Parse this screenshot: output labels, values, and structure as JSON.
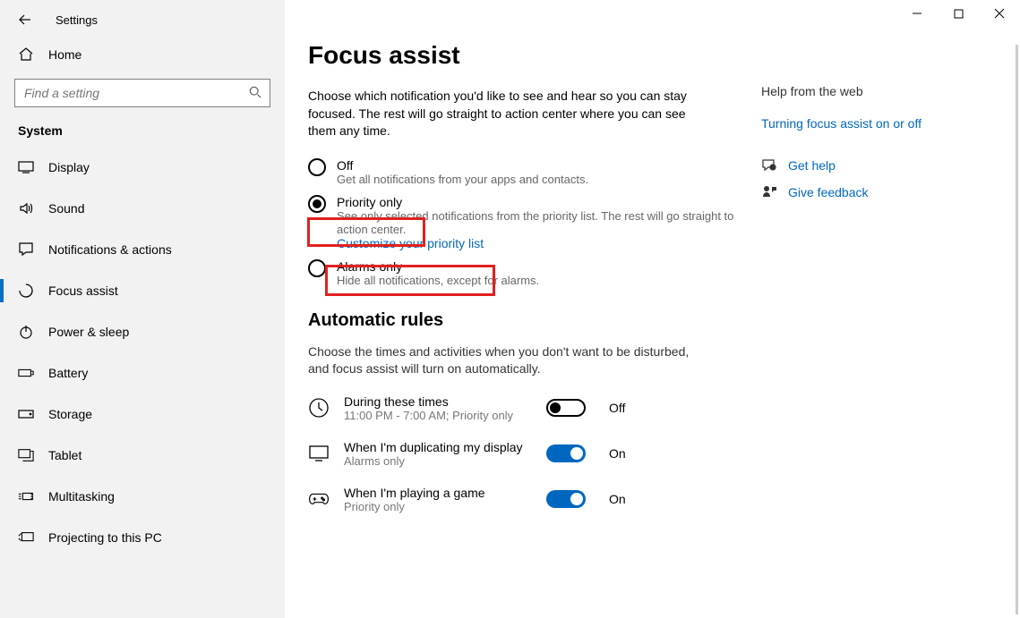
{
  "window": {
    "title": "Settings",
    "controls": {
      "min": "−",
      "max": "▢",
      "close": "✕"
    }
  },
  "sidebar": {
    "home": "Home",
    "search_placeholder": "Find a setting",
    "section": "System",
    "items": [
      {
        "icon": "display-icon",
        "label": "Display"
      },
      {
        "icon": "sound-icon",
        "label": "Sound"
      },
      {
        "icon": "notifications-icon",
        "label": "Notifications & actions"
      },
      {
        "icon": "focus-icon",
        "label": "Focus assist",
        "active": true
      },
      {
        "icon": "power-icon",
        "label": "Power & sleep"
      },
      {
        "icon": "battery-icon",
        "label": "Battery"
      },
      {
        "icon": "storage-icon",
        "label": "Storage"
      },
      {
        "icon": "tablet-icon",
        "label": "Tablet"
      },
      {
        "icon": "multitask-icon",
        "label": "Multitasking"
      },
      {
        "icon": "project-icon",
        "label": "Projecting to this PC"
      }
    ]
  },
  "page": {
    "title": "Focus assist",
    "desc": "Choose which notification you'd like to see and hear so you can stay focused. The rest will go straight to action center where you can see them any time.",
    "options": {
      "off": {
        "title": "Off",
        "sub": "Get all notifications from your apps and contacts."
      },
      "priority": {
        "title": "Priority only",
        "sub": "See only selected notifications from the priority list. The rest will go straight to action center.",
        "link": "Customize your priority list"
      },
      "alarms": {
        "title": "Alarms only",
        "sub": "Hide all notifications, except for alarms."
      }
    },
    "auto": {
      "heading": "Automatic rules",
      "desc": "Choose the times and activities when you don't want to be disturbed, and focus assist will turn on automatically.",
      "rules": [
        {
          "icon": "clock-icon",
          "title": "During these times",
          "sub": "11:00 PM - 7:00 AM; Priority only",
          "state": "off",
          "state_label": "Off"
        },
        {
          "icon": "monitor-icon",
          "title": "When I'm duplicating my display",
          "sub": "Alarms only",
          "state": "on",
          "state_label": "On"
        },
        {
          "icon": "game-icon",
          "title": "When I'm playing a game",
          "sub": "Priority only",
          "state": "on",
          "state_label": "On"
        }
      ]
    }
  },
  "help": {
    "heading": "Help from the web",
    "link": "Turning focus assist on or off",
    "get_help": "Get help",
    "feedback": "Give feedback"
  }
}
